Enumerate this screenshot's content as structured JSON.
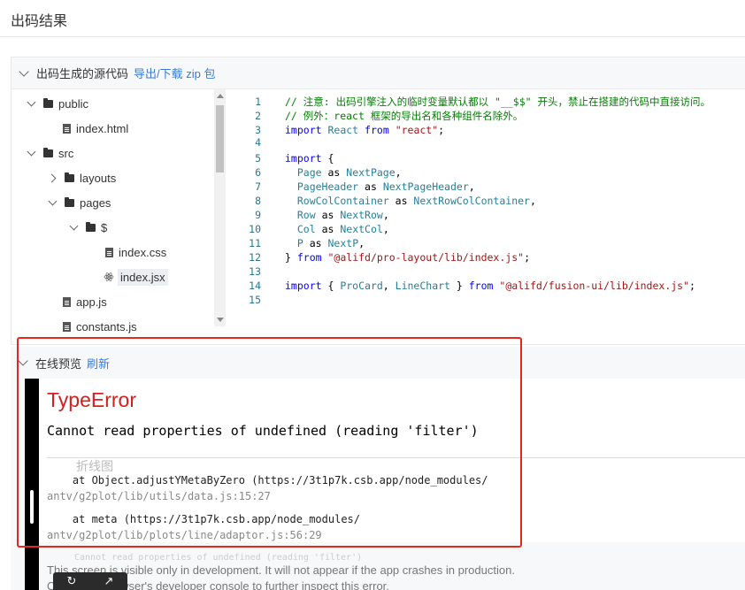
{
  "page": {
    "title": "出码结果"
  },
  "code_section": {
    "title": "出码生成的源代码",
    "export_link": "导出/下载 zip 包"
  },
  "file_tree": [
    {
      "label": "public",
      "type": "folder",
      "state": "open"
    },
    {
      "label": "index.html",
      "type": "file"
    },
    {
      "label": "src",
      "type": "folder",
      "state": "open"
    },
    {
      "label": "layouts",
      "type": "folder",
      "state": "closed"
    },
    {
      "label": "pages",
      "type": "folder",
      "state": "open"
    },
    {
      "label": "$",
      "type": "folder",
      "state": "open"
    },
    {
      "label": "index.css",
      "type": "file"
    },
    {
      "label": "index.jsx",
      "type": "react-file",
      "selected": true
    },
    {
      "label": "app.js",
      "type": "file"
    },
    {
      "label": "constants.js",
      "type": "file"
    }
  ],
  "code_lines": [
    {
      "n": "1",
      "tokens": [
        [
          "cm",
          "// 注意: 出码引擎注入的临时变量默认都以 \"__$$\" 开头，禁止在搭建的代码中直接访问。"
        ]
      ]
    },
    {
      "n": "2",
      "tokens": [
        [
          "cm",
          "// 例外：react 框架的导出名和各种组件名除外。"
        ]
      ]
    },
    {
      "n": "3",
      "tokens": [
        [
          "kw",
          "import"
        ],
        [
          "pl",
          " "
        ],
        [
          "id",
          "React"
        ],
        [
          "pl",
          " "
        ],
        [
          "kw",
          "from"
        ],
        [
          "pl",
          " "
        ],
        [
          "str",
          "\"react\""
        ],
        [
          "pl",
          ";"
        ]
      ]
    },
    {
      "n": "4",
      "tokens": []
    },
    {
      "n": "5",
      "tokens": [
        [
          "kw",
          "import"
        ],
        [
          "pl",
          " {"
        ]
      ]
    },
    {
      "n": "6",
      "tokens": [
        [
          "pl",
          "  "
        ],
        [
          "id",
          "Page"
        ],
        [
          "pl",
          " as "
        ],
        [
          "id",
          "NextPage"
        ],
        [
          "pl",
          ","
        ]
      ]
    },
    {
      "n": "7",
      "tokens": [
        [
          "pl",
          "  "
        ],
        [
          "id",
          "PageHeader"
        ],
        [
          "pl",
          " as "
        ],
        [
          "id",
          "NextPageHeader"
        ],
        [
          "pl",
          ","
        ]
      ]
    },
    {
      "n": "8",
      "tokens": [
        [
          "pl",
          "  "
        ],
        [
          "id",
          "RowColContainer"
        ],
        [
          "pl",
          " as "
        ],
        [
          "id",
          "NextRowColContainer"
        ],
        [
          "pl",
          ","
        ]
      ]
    },
    {
      "n": "9",
      "tokens": [
        [
          "pl",
          "  "
        ],
        [
          "id",
          "Row"
        ],
        [
          "pl",
          " as "
        ],
        [
          "id",
          "NextRow"
        ],
        [
          "pl",
          ","
        ]
      ]
    },
    {
      "n": "10",
      "tokens": [
        [
          "pl",
          "  "
        ],
        [
          "id",
          "Col"
        ],
        [
          "pl",
          " as "
        ],
        [
          "id",
          "NextCol"
        ],
        [
          "pl",
          ","
        ]
      ]
    },
    {
      "n": "11",
      "tokens": [
        [
          "pl",
          "  "
        ],
        [
          "id",
          "P"
        ],
        [
          "pl",
          " as "
        ],
        [
          "id",
          "NextP"
        ],
        [
          "pl",
          ","
        ]
      ]
    },
    {
      "n": "12",
      "tokens": [
        [
          "pl",
          "} "
        ],
        [
          "kw",
          "from"
        ],
        [
          "pl",
          " "
        ],
        [
          "str",
          "\"@alifd/pro-layout/lib/index.js\""
        ],
        [
          "pl",
          ";"
        ]
      ]
    },
    {
      "n": "13",
      "tokens": []
    },
    {
      "n": "14",
      "tokens": [
        [
          "kw",
          "import"
        ],
        [
          "pl",
          " { "
        ],
        [
          "id",
          "ProCard"
        ],
        [
          "pl",
          ", "
        ],
        [
          "id",
          "LineChart"
        ],
        [
          "pl",
          " } "
        ],
        [
          "kw",
          "from"
        ],
        [
          "pl",
          " "
        ],
        [
          "str",
          "\"@alifd/fusion-ui/lib/index.js\""
        ],
        [
          "pl",
          ";"
        ]
      ]
    },
    {
      "n": "15",
      "tokens": []
    }
  ],
  "preview_section": {
    "title": "在线预览",
    "refresh_link": "刷新"
  },
  "error_overlay": {
    "title": "TypeError",
    "message": "Cannot read properties of undefined (reading 'filter')",
    "ghost_title": "折线图",
    "stack": [
      {
        "call": "    at Object.adjustYMetaByZero (https://3t1p7k.csb.app/node_modules/",
        "file": "antv/g2plot/lib/utils/data.js:15:27"
      },
      {
        "call": "    at meta (https://3t1p7k.csb.app/node_modules/",
        "file": "antv/g2plot/lib/plots/line/adaptor.js:56:29"
      }
    ],
    "ghost_error": "Cannot read properties of undefined (reading 'filter')",
    "dev_note": "This screen is visible only in development. It will not appear if the app crashes in production.",
    "dev_note2": "Open your browser's developer console to further inspect this error."
  },
  "controls": {
    "reload_icon": "reload-icon",
    "popout_icon": "external-link-icon"
  },
  "colors": {
    "link": "#3a7bd5",
    "error": "#d32020",
    "highlight": "#e5271c"
  }
}
